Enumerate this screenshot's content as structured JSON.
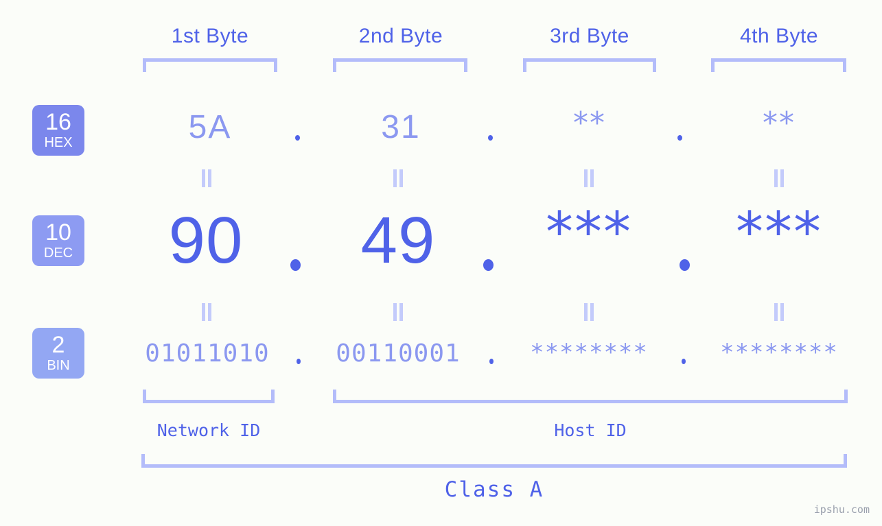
{
  "meta": {
    "background_color": "#fbfdf9",
    "accent_strong": "#4f62e8",
    "accent_light": "#8b98f0",
    "accent_rule": "#b3bcfa",
    "badge_hex_color": "#7b87ec",
    "badge_dec_color": "#8d9bf2",
    "badge_bin_color": "#93a7f3"
  },
  "byte_headers": [
    {
      "label": "1st Byte"
    },
    {
      "label": "2nd Byte"
    },
    {
      "label": "3rd Byte"
    },
    {
      "label": "4th Byte"
    }
  ],
  "bases": [
    {
      "number": "16",
      "name": "HEX"
    },
    {
      "number": "10",
      "name": "DEC"
    },
    {
      "number": "2",
      "name": "BIN"
    }
  ],
  "rows": {
    "hex": {
      "values": [
        "5A",
        "31",
        "**",
        "**"
      ]
    },
    "dec": {
      "values": [
        "90",
        "49",
        "***",
        "***"
      ]
    },
    "bin": {
      "values": [
        "01011010",
        "00110001",
        "********",
        "********"
      ]
    }
  },
  "separators": {
    "dot": "."
  },
  "equals_symbol": "=",
  "segments": {
    "network_id": "Network ID",
    "host_id": "Host ID"
  },
  "class_label": "Class A",
  "watermark": "ipshu.com"
}
